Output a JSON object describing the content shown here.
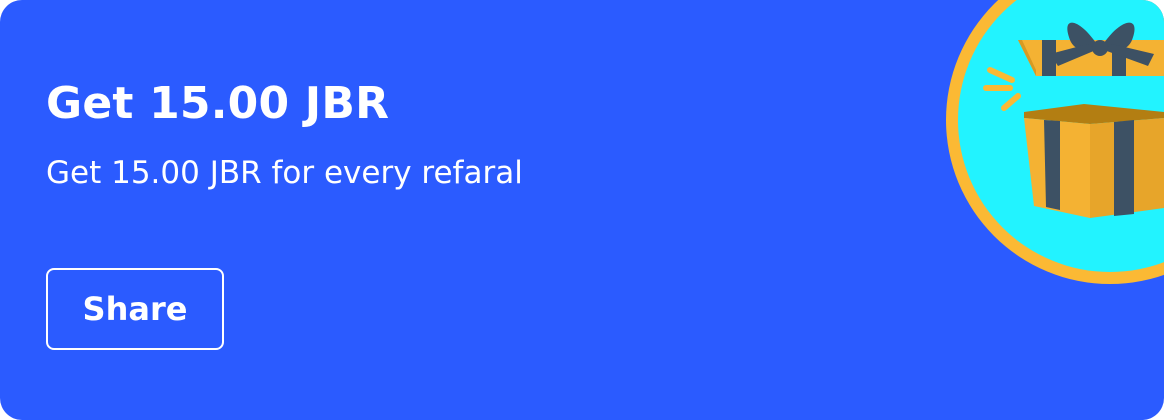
{
  "promo": {
    "title": "Get 15.00 JBR",
    "subtitle": "Get 15.00 JBR for every refaral",
    "share_label": "Share"
  },
  "colors": {
    "card_background": "#2b5bff",
    "circle_fill": "#22f3ff",
    "circle_ring": "#fbb934",
    "box_gold": "#f4b233",
    "box_stripe": "#3d5164",
    "text": "#ffffff"
  },
  "icons": {
    "illustration": "open-gift-box-icon"
  }
}
